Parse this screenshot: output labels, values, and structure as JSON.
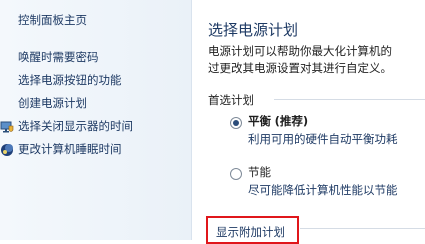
{
  "sidebar": {
    "home_link": "控制面板主页",
    "links": [
      {
        "label": "唤醒时需要密码",
        "icon": null
      },
      {
        "label": "选择电源按钮的功能",
        "icon": null
      },
      {
        "label": "创建电源计划",
        "icon": null
      },
      {
        "label": "选择关闭显示器的时间",
        "icon": "monitor-shield-icon"
      },
      {
        "label": "更改计算机睡眠时间",
        "icon": "moon-globe-icon"
      }
    ]
  },
  "main": {
    "title": "选择电源计划",
    "description_line1": "电源计划可以帮助你最大化计算机的",
    "description_line2": "过更改其电源设置对其进行自定义。",
    "preferred_section": "首选计划",
    "plans": [
      {
        "name": "平衡",
        "suffix": "(推荐)",
        "description": "利用可用的硬件自动平衡功耗",
        "selected": true
      },
      {
        "name": "节能",
        "suffix": "",
        "description": "尽可能降低计算机性能以节能",
        "selected": false
      }
    ],
    "show_additional": "显示附加计划"
  },
  "colors": {
    "link": "#1e3a64",
    "highlight_border": "#e0161b"
  }
}
